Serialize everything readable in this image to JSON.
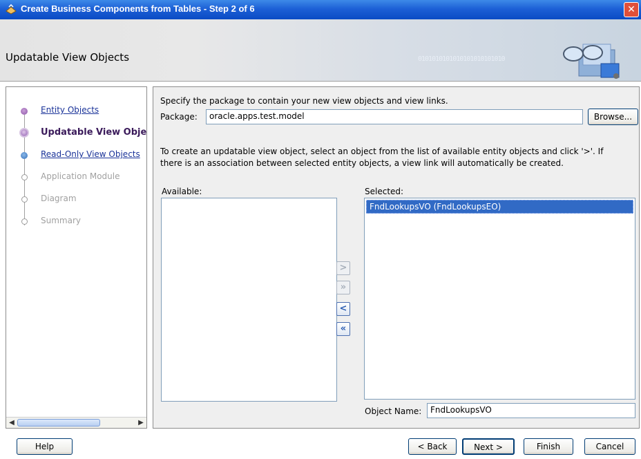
{
  "window": {
    "title": "Create Business Components from Tables - Step 2 of 6",
    "close_glyph": "✕"
  },
  "header": {
    "title": "Updatable View Objects",
    "binary_decoration": "0101010101010101010101010"
  },
  "steps": [
    {
      "label": "Entity Objects",
      "state": "visited"
    },
    {
      "label": "Updatable View Obje",
      "state": "current"
    },
    {
      "label": "Read-Only View Objects",
      "state": "visited"
    },
    {
      "label": "Application Module",
      "state": "disabled"
    },
    {
      "label": "Diagram",
      "state": "disabled"
    },
    {
      "label": "Summary",
      "state": "disabled"
    }
  ],
  "main": {
    "package_instruction": "Specify the package to contain your new view objects and view links.",
    "package_label": "Package:",
    "package_value": "oracle.apps.test.model",
    "browse_label": "Browse...",
    "help_text_line1": "To create an updatable view object, select an object from the list of available entity objects and click '>'.  If",
    "help_text_line2": "there is an association between selected entity objects, a view link will automatically be created.",
    "available_label": "Available:",
    "available_items": [],
    "selected_label": "Selected:",
    "selected_items": [
      "FndLookupsVO (FndLookupsEO)"
    ],
    "object_name_label": "Object Name:",
    "object_name_value": "FndLookupsVO",
    "shuttle": {
      "move": ">",
      "move_all": "»",
      "remove": "<",
      "remove_all": "«"
    }
  },
  "footer": {
    "help": "Help",
    "back": "< Back",
    "next": "Next >",
    "finish": "Finish",
    "cancel": "Cancel"
  }
}
